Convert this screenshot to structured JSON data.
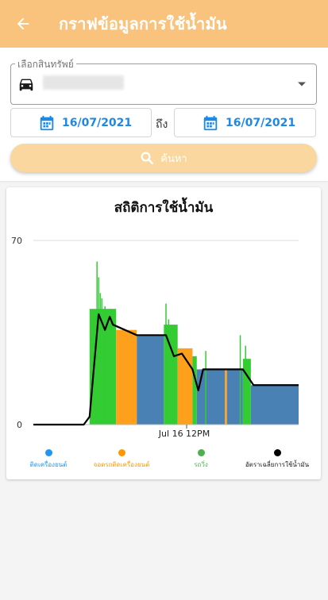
{
  "header": {
    "title": "กราฟข้อมูลการใช้น้ำมัน",
    "back_icon": "arrow-left-icon"
  },
  "filter": {
    "vehicle_label": "เลือกสินทรัพย์",
    "vehicle_icon": "car-icon",
    "date_from": "16/07/2021",
    "date_to": "16/07/2021",
    "to_label": "ถึง",
    "search_label": "ค้นหา"
  },
  "colors": {
    "accent": "#f9c37e",
    "date_text": "#1e88e5",
    "engine_on": "#2196f3",
    "idling": "#ff9800",
    "moving": "#4caf50",
    "avg_rate": "#000000"
  },
  "chart_data": {
    "type": "area",
    "title": "สถิติการใช้น้ำมัน",
    "ylim": [
      0,
      70
    ],
    "yticks": [
      0,
      70
    ],
    "xtick_label": "Jul 16 12PM",
    "grid": true,
    "legend_position": "bottom",
    "legend": [
      {
        "label": "ติดเครื่องยนต์",
        "color": "#2196f3"
      },
      {
        "label": "จอดรถติดเครื่องยนต์",
        "color": "#ff9800"
      },
      {
        "label": "รถวิ่ง",
        "color": "#4caf50"
      },
      {
        "label": "อัตราเฉลี่ยการใช้น้ำมัน",
        "color": "#000000"
      }
    ],
    "segments": [
      {
        "state": "moving",
        "from": 0.212,
        "to": 0.312,
        "value": 44
      },
      {
        "state": "idling",
        "from": 0.312,
        "to": 0.39,
        "value": 36
      },
      {
        "state": "engine_on",
        "from": 0.39,
        "to": 0.492,
        "value": 34
      },
      {
        "state": "moving",
        "from": 0.492,
        "to": 0.544,
        "value": 38
      },
      {
        "state": "idling",
        "from": 0.544,
        "to": 0.6,
        "value": 29
      },
      {
        "state": "moving",
        "from": 0.6,
        "to": 0.616,
        "value": 26
      },
      {
        "state": "engine_on",
        "from": 0.616,
        "to": 0.722,
        "value": 21
      },
      {
        "state": "idling",
        "from": 0.722,
        "to": 0.73,
        "value": 21
      },
      {
        "state": "engine_on",
        "from": 0.73,
        "to": 0.79,
        "value": 21
      },
      {
        "state": "moving",
        "from": 0.79,
        "to": 0.82,
        "value": 25
      },
      {
        "state": "engine_on",
        "from": 0.82,
        "to": 1.0,
        "value": 15
      }
    ],
    "spikes": [
      {
        "x": 0.24,
        "value": 62
      },
      {
        "x": 0.246,
        "value": 56
      },
      {
        "x": 0.252,
        "value": 50
      },
      {
        "x": 0.258,
        "value": 48
      },
      {
        "x": 0.27,
        "value": 45
      },
      {
        "x": 0.29,
        "value": 44
      },
      {
        "x": 0.5,
        "value": 46
      },
      {
        "x": 0.51,
        "value": 40
      },
      {
        "x": 0.53,
        "value": 34
      },
      {
        "x": 0.65,
        "value": 28
      },
      {
        "x": 0.78,
        "value": 34
      },
      {
        "x": 0.8,
        "value": 30
      }
    ],
    "avg_line": [
      {
        "x": 0.0,
        "y": 0
      },
      {
        "x": 0.19,
        "y": 0
      },
      {
        "x": 0.212,
        "y": 3
      },
      {
        "x": 0.246,
        "y": 42
      },
      {
        "x": 0.27,
        "y": 36
      },
      {
        "x": 0.288,
        "y": 41
      },
      {
        "x": 0.3,
        "y": 38
      },
      {
        "x": 0.39,
        "y": 34
      },
      {
        "x": 0.5,
        "y": 34
      },
      {
        "x": 0.53,
        "y": 26
      },
      {
        "x": 0.56,
        "y": 27
      },
      {
        "x": 0.6,
        "y": 21
      },
      {
        "x": 0.622,
        "y": 13
      },
      {
        "x": 0.64,
        "y": 21
      },
      {
        "x": 0.79,
        "y": 21
      },
      {
        "x": 0.83,
        "y": 15
      },
      {
        "x": 1.0,
        "y": 15
      }
    ]
  }
}
